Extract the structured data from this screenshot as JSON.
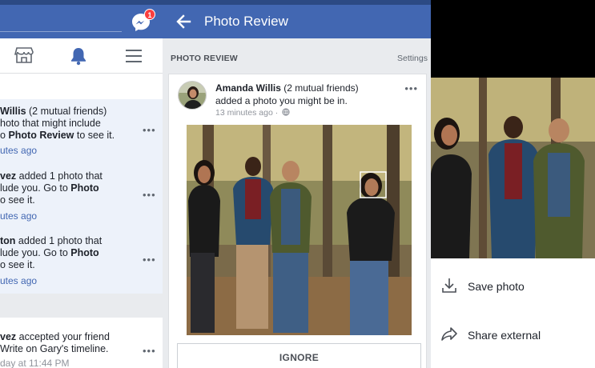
{
  "notifications_panel": {
    "messenger_badge": "1",
    "items": [
      {
        "line1_bold": "Willis",
        "line1_rest": " (2 mutual friends)",
        "line2": "hoto that might include",
        "line3_pre": "o ",
        "line3_bold": "Photo Review",
        "line3_post": " to see it.",
        "time": "utes ago"
      },
      {
        "line1_bold": "vez",
        "line1_rest": " added 1 photo that",
        "line2": "lude you. Go to ",
        "line2_bold": "Photo",
        "line3": "o see it.",
        "time": "utes ago"
      },
      {
        "line1_bold": "ton",
        "line1_rest": " added 1 photo that",
        "line2": "lude you. Go to ",
        "line2_bold": "Photo",
        "line3": "o see it.",
        "time": "utes ago"
      },
      {
        "line1_bold": "vez",
        "line1_rest": " accepted your friend",
        "line2": "Write on Gary's timeline.",
        "time": "day at 11:44 PM"
      }
    ]
  },
  "photo_review": {
    "header_title": "Photo Review",
    "section_title": "PHOTO REVIEW",
    "settings_label": "Settings",
    "card": {
      "author": "Amanda Willis",
      "author_suffix": " (2 mutual friends)",
      "action": "added a photo you might be in.",
      "time": "13 minutes ago ·",
      "ignore_label": "IGNORE"
    }
  },
  "photo_menu": {
    "items": [
      {
        "label": "Save photo",
        "icon": "download-icon"
      },
      {
        "label": "Share external",
        "icon": "share-icon"
      }
    ]
  },
  "colors": {
    "facebook_blue": "#4267b2",
    "unread_bg": "#edf2fa",
    "link_blue": "#4267b2",
    "badge_red": "#fa3e3e"
  }
}
